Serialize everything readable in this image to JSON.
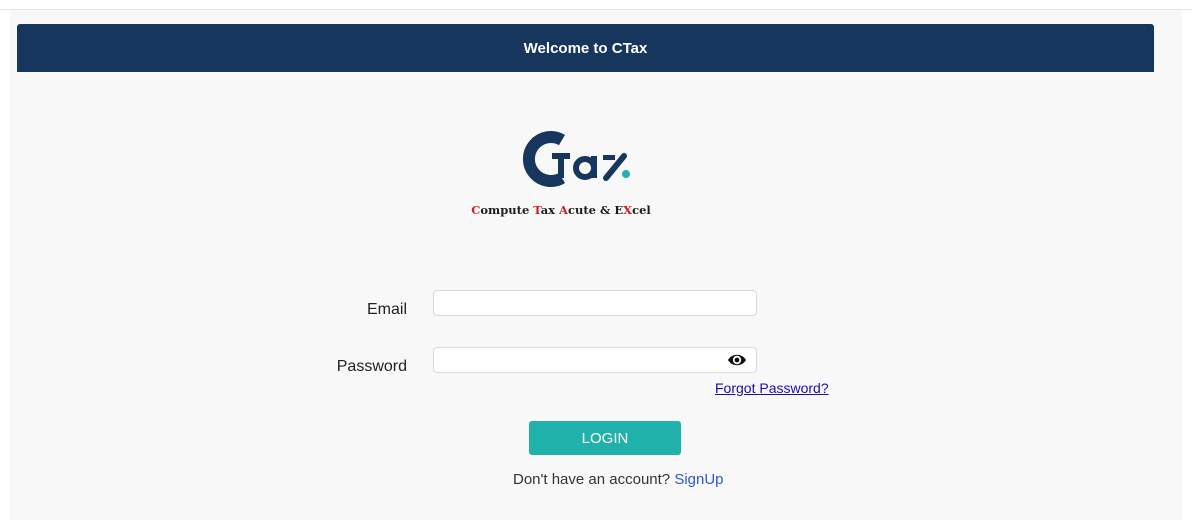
{
  "header": {
    "title": "Welcome to CTax"
  },
  "logo": {
    "text": "CTax",
    "tagline_parts": [
      {
        "text": "C",
        "color": "#d01c1c"
      },
      {
        "text": "ompute ",
        "color": "#1c1c1c"
      },
      {
        "text": "T",
        "color": "#d01c1c"
      },
      {
        "text": "ax ",
        "color": "#1c1c1c"
      },
      {
        "text": "A",
        "color": "#d01c1c"
      },
      {
        "text": "cute & E",
        "color": "#1c1c1c"
      },
      {
        "text": "X",
        "color": "#d01c1c"
      },
      {
        "text": "cel",
        "color": "#1c1c1c"
      }
    ],
    "brand_color": "#17365d",
    "accent_color": "#20b2aa"
  },
  "form": {
    "email_label": "Email",
    "email_value": "",
    "password_label": "Password",
    "password_value": "",
    "password_toggle_icon": "eye-icon",
    "forgot_password": "Forgot Password?",
    "login_label": "LOGIN",
    "signup_prompt": "Don't have an account?",
    "signup_link": "SignUp"
  },
  "colors": {
    "header_bg": "#17365d",
    "button_bg": "#20b2aa",
    "link": "#1a0dab"
  }
}
